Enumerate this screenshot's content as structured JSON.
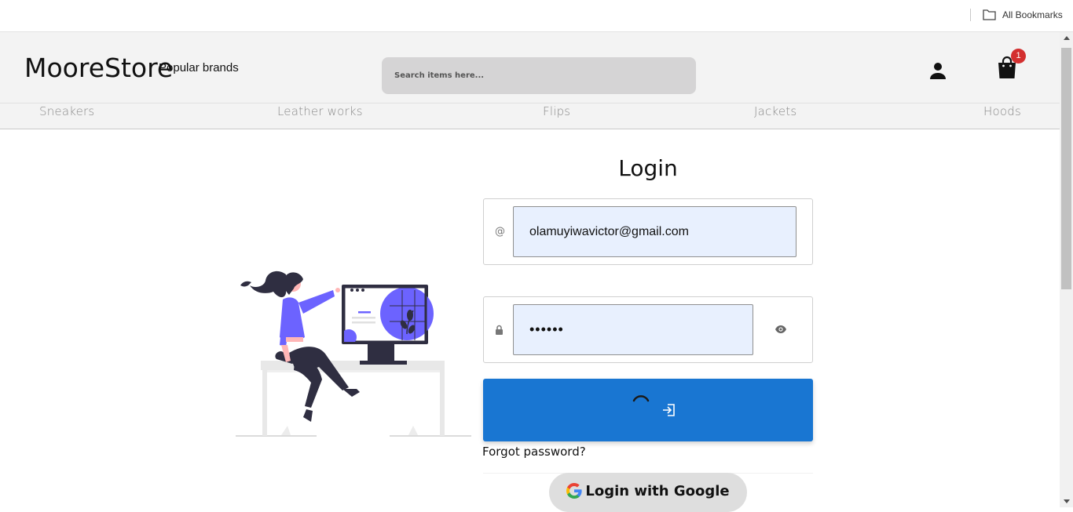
{
  "bookmarks": {
    "all_label": "All Bookmarks",
    "icon": "folder-icon"
  },
  "header": {
    "logo": "MooreStore",
    "popular": "Popular brands",
    "search_placeholder": "Search items here...",
    "cart_count": "1",
    "badge_color": "#d32f2f"
  },
  "categories": [
    "Sneakers",
    "Leather works",
    "Flips",
    "Jackets",
    "Hoods"
  ],
  "login": {
    "title": "Login",
    "email_icon": "@",
    "email_value": "olamuyiwavictor@gmail.com",
    "password_value": "••••••",
    "forgot": "Forgot password?",
    "google_label": "Login with Google",
    "button_color": "#1976d2"
  }
}
